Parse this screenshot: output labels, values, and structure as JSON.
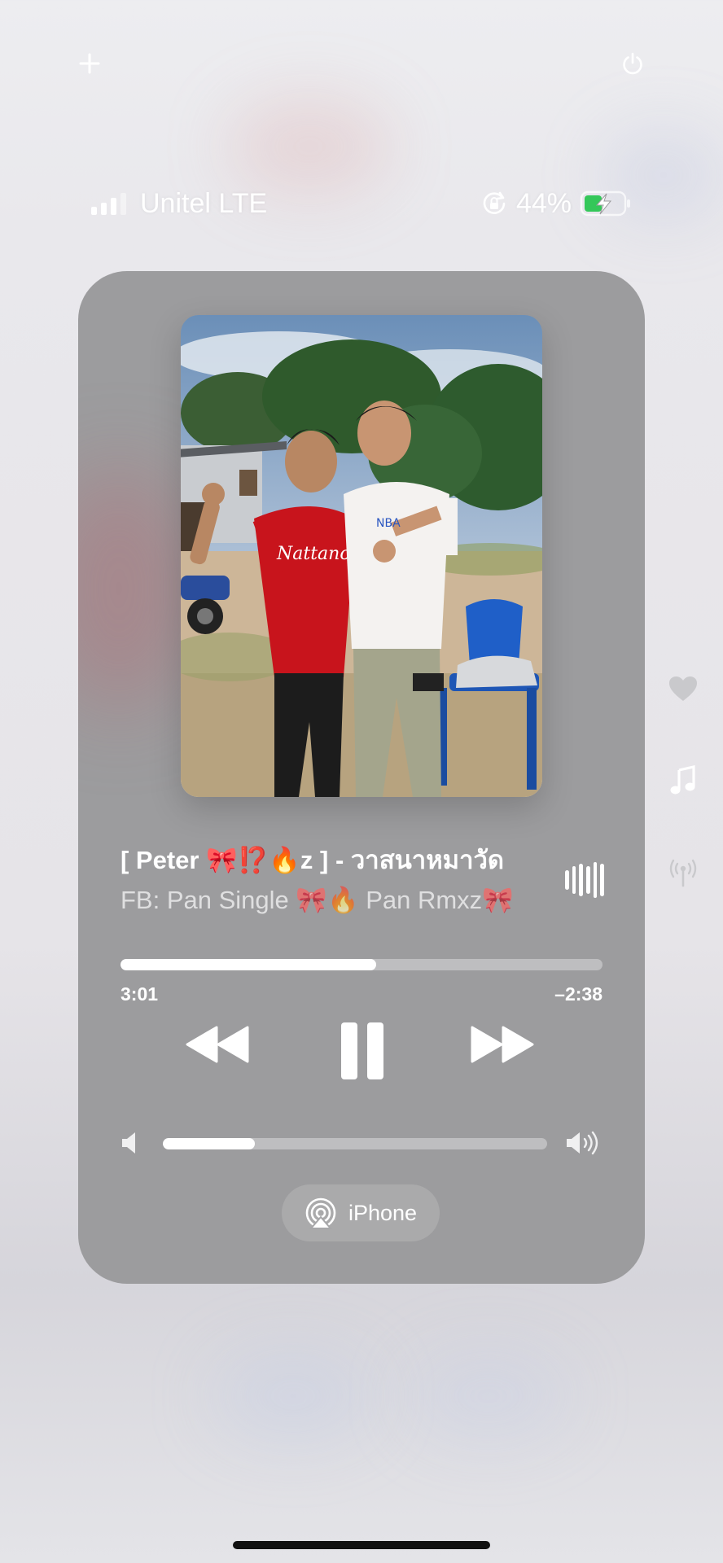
{
  "header": {
    "add_icon": "plus-icon",
    "power_icon": "power-icon"
  },
  "status_bar": {
    "carrier": "Unitel LTE",
    "battery_percent": "44%",
    "battery_level": 0.44,
    "signal_bars": 3,
    "battery_color": "#34c759"
  },
  "now_playing": {
    "title": "[ Peter 🎀⁉️🔥z ] - วาสนาหมาวัด",
    "artist": "FB: Pan Single 🎀🔥 Pan Rmxz🎀",
    "elapsed": "3:01",
    "remaining": "–2:38",
    "progress": 0.53,
    "volume": 0.24,
    "output_device": "iPhone"
  },
  "side_controls": [
    "heart-icon",
    "music-note-icon",
    "broadcast-icon"
  ],
  "colors": {
    "player_background": "#9c9c9e",
    "page_background": "#ececf0"
  }
}
